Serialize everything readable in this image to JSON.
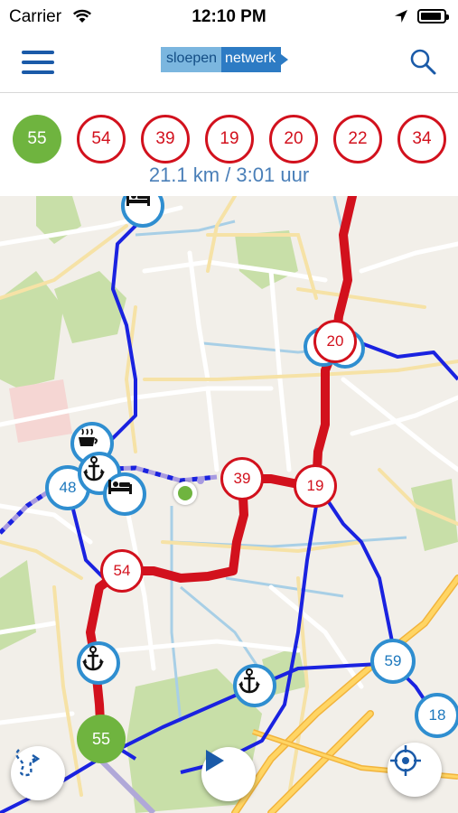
{
  "status_bar": {
    "carrier": "Carrier",
    "time": "12:10 PM",
    "battery_level": 0.9
  },
  "header": {
    "logo_part1": "sloepen",
    "logo_part2": "netwerk"
  },
  "route": {
    "start_node": "55",
    "nodes": [
      "54",
      "39",
      "19",
      "20",
      "22",
      "34"
    ],
    "summary": "21.1 km / 3:01 uur"
  },
  "map": {
    "route_nodes": [
      "20",
      "39",
      "19",
      "54"
    ],
    "network_nodes": [
      "48",
      "59",
      "18"
    ],
    "start_marker": "55",
    "poi": [
      "bed-icon",
      "cafe-icon",
      "anchor-icon",
      "anchor-icon",
      "anchor-icon"
    ]
  },
  "colors": {
    "route_red": "#d2111d",
    "network_blue": "#1a22e0",
    "node_blue": "#2f8ed0",
    "start_green": "#6fb43f",
    "header_blue": "#1a5aa8",
    "summary_blue": "#4a7fb8"
  }
}
